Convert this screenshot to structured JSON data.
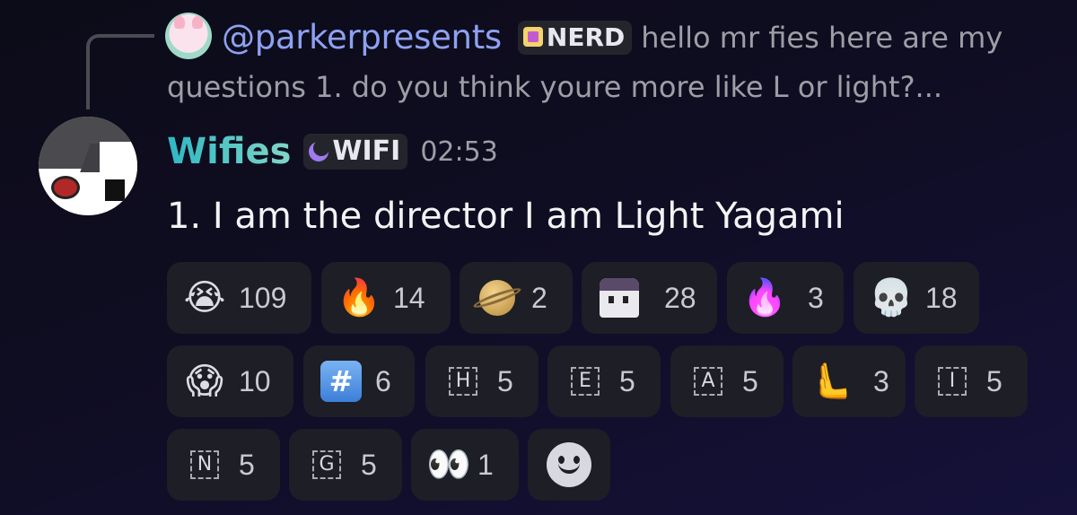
{
  "reply": {
    "username": "@parkerpresents",
    "tag": "NERD",
    "preview_line1": "hello mr fies here are my",
    "preview_line2": "questions  1.  do you think youre more like L or light?..."
  },
  "message": {
    "author": "Wifies",
    "tag": "WIFI",
    "timestamp": "02:53",
    "content": "1.  I am the director I am Light Yagami"
  },
  "reactions": [
    {
      "icon": "loudly-crying-face-icon",
      "glyph": "😭",
      "count": "109"
    },
    {
      "icon": "fire-icon",
      "glyph": "🔥",
      "count": "14"
    },
    {
      "icon": "ringed-planet-icon",
      "glyph": "",
      "count": "2"
    },
    {
      "icon": "custom-ghost-emoji-icon",
      "glyph": "",
      "count": "28"
    },
    {
      "icon": "purple-fire-icon",
      "glyph": "🔥",
      "count": "3"
    },
    {
      "icon": "skull-icon",
      "glyph": "💀",
      "count": "18"
    },
    {
      "icon": "face-screaming-in-fear-icon",
      "glyph": "😱",
      "count": "10"
    },
    {
      "icon": "keycap-hash-icon",
      "glyph": "#",
      "count": "6"
    },
    {
      "icon": "regional-indicator-h-icon",
      "glyph": "H",
      "count": "5"
    },
    {
      "icon": "regional-indicator-e-icon",
      "glyph": "E",
      "count": "5"
    },
    {
      "icon": "regional-indicator-a-icon",
      "glyph": "A",
      "count": "5"
    },
    {
      "icon": "raised-back-of-hand-icon",
      "glyph": "🫷",
      "count": "3"
    },
    {
      "icon": "regional-indicator-i-icon",
      "glyph": "I",
      "count": "5"
    },
    {
      "icon": "regional-indicator-n-icon",
      "glyph": "N",
      "count": "5"
    },
    {
      "icon": "regional-indicator-g-icon",
      "glyph": "G",
      "count": "5"
    },
    {
      "icon": "eyes-icon",
      "glyph": "👀",
      "count": "1"
    },
    {
      "icon": "add-reaction-smiley-icon",
      "glyph": "",
      "count": ""
    }
  ],
  "colors": {
    "username_reply": "#8ea1f2",
    "author_gradient_start": "#2fb8c4",
    "author_gradient_end": "#7fd6c6",
    "reaction_bg": "#1d1e26",
    "background": "#0f0d22"
  }
}
